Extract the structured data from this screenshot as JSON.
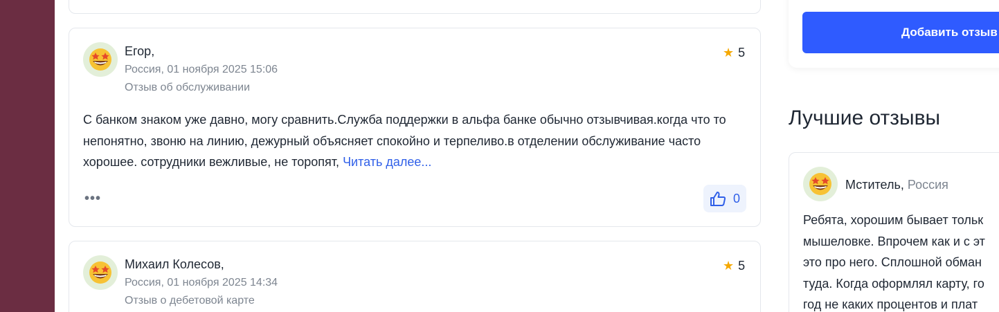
{
  "reviews": [
    {
      "author": "Егор,",
      "location_date": "Россия, 01 ноября 2025 15:06",
      "category": "Отзыв об обслуживании",
      "rating": "5",
      "text": "С банком знаком уже давно, могу сравнить.Служба поддержки в альфа банке обычно отзывчивая.когда что то непонятно, звоню на линию, дежурный объясняет спокойно и терпеливо.в отделении обслуживание часто хорошее. сотрудники вежливые, не торопят,",
      "read_more": "Читать далее...",
      "likes": "0",
      "more_label": "•••"
    },
    {
      "author": "Михаил Колесов,",
      "location_date": "Россия, 01 ноября 2025 14:34",
      "category": "Отзыв о дебетовой карте",
      "rating": "5"
    }
  ],
  "sidebar": {
    "add_review_label": "Добавить отзыв",
    "best_reviews_title": "Лучшие отзывы",
    "best_review": {
      "author": "Мститель,",
      "country": "Россия",
      "lines": [
        "Ребята, хорошим бывает тольк",
        "мышеловке. Впрочем как и с эт",
        "это про него. Сплошной обман",
        "туда. Когда оформлял карту, го",
        "год не каких процентов и плат"
      ]
    }
  },
  "colors": {
    "accent": "#2f5bff",
    "link": "#2f5fe8",
    "star": "#f5a800",
    "left_strip": "#6b2d42"
  },
  "icons": {
    "avatar": "star-struck-emoji-icon",
    "rating": "star-icon",
    "like": "thumbs-up-icon",
    "more": "more-dots-icon"
  }
}
